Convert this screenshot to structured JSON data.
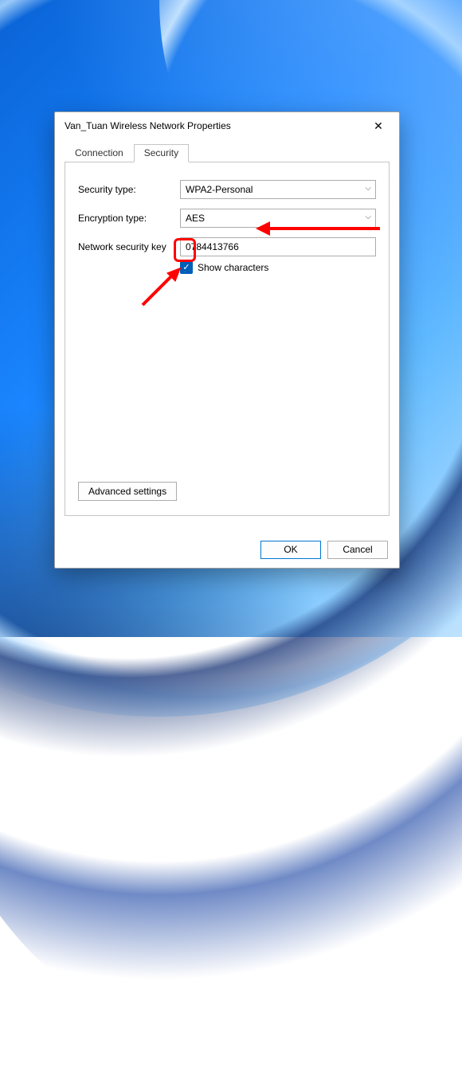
{
  "window": {
    "title": "Van_Tuan Wireless Network Properties"
  },
  "tabs": {
    "connection": "Connection",
    "security": "Security",
    "active": "security"
  },
  "form": {
    "security_type_label": "Security type:",
    "security_type_value": "WPA2-Personal",
    "encryption_type_label": "Encryption type:",
    "encryption_type_value": "AES",
    "network_key_label": "Network security key",
    "network_key_value": "0784413766",
    "show_characters_label": "Show characters",
    "show_characters_checked": true
  },
  "buttons": {
    "advanced": "Advanced settings",
    "ok": "OK",
    "cancel": "Cancel"
  }
}
